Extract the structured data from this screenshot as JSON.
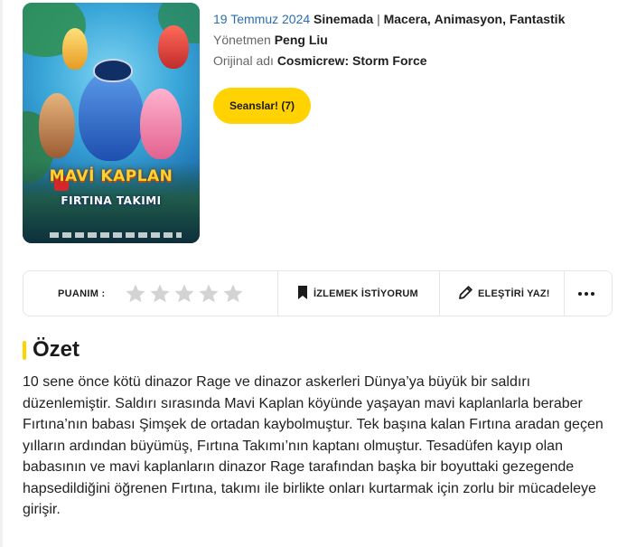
{
  "movie": {
    "release_date": "19 Temmuz 2024",
    "status": "Sinemada",
    "separator": "|",
    "genres": [
      "Macera",
      "Animasyon",
      "Fantastik"
    ],
    "director_label": "Yönetmen",
    "director": "Peng Liu",
    "original_title_label": "Orijinal adı",
    "original_title": "Cosmicrew: Storm Force",
    "poster_title_line1": "MAVİ KAPLAN",
    "poster_title_line2": "FIRTINA TAKIMI",
    "sessions_button": "Seanslar! (7)"
  },
  "actions": {
    "rating_label": "PUANIM :",
    "star_count": 5,
    "stars_filled": 0,
    "watchlist": "İZLEMEK İSTİYORUM",
    "write_review": "ELEŞTİRİ YAZ!",
    "more": "•••"
  },
  "summary": {
    "title": "Özet",
    "text": "10 sene önce kötü dinazor Rage ve dinazor askerleri Dünya’ya büyük bir saldırı düzenlemiştir. Saldırı sırasında Mavi Kaplan köyünde yaşayan mavi kaplanlarla beraber Fırtına’nın babası Şimşek de ortadan kaybolmuştur. Tek başına kalan Fırtına aradan geçen yılların ardından büyümüş, Fırtına Takımı’nın kaptanı olmuştur. Tesadüfen kayıp olan babasının ve mavi kaplanların dinazor Rage tarafından  başka bir boyuttaki gezegende hapsedildiğini öğrenen Fırtına, takımı ile birlikte onları kurtarmak için zorlu bir mücadeleye girişir."
  },
  "colors": {
    "accent": "#ffd200",
    "date": "#2a6fb0",
    "star": "#d3d3d3"
  }
}
